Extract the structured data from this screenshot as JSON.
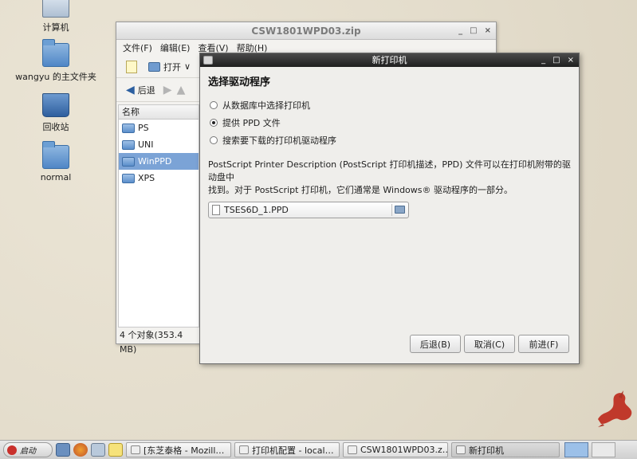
{
  "desktop": {
    "icons": [
      {
        "label": "计算机"
      },
      {
        "label": "wangyu 的主文件夹"
      },
      {
        "label": "回收站"
      },
      {
        "label": "normal"
      }
    ]
  },
  "file_manager": {
    "title": "CSW1801WPD03.zip",
    "window_controls": {
      "min": "_",
      "max": "□",
      "close": "×"
    },
    "menu": [
      "文件(F)",
      "编辑(E)",
      "查看(V)",
      "帮助(H)"
    ],
    "toolbar": {
      "open_label": "打开",
      "dropdown": "∨"
    },
    "nav": {
      "back_label": "后退"
    },
    "list_header": "名称",
    "items": [
      "PS",
      "UNI",
      "WinPPD",
      "XPS"
    ],
    "status": "4 个对象(353.4 MB)"
  },
  "dialog": {
    "title": "新打印机",
    "window_controls": {
      "min": "_",
      "max": "□",
      "close": "×"
    },
    "heading": "选择驱动程序",
    "options": [
      {
        "label": "从数据库中选择打印机",
        "checked": false
      },
      {
        "label": "提供 PPD 文件",
        "checked": true
      },
      {
        "label": "搜索要下载的打印机驱动程序",
        "checked": false
      }
    ],
    "description_line1": "PostScript Printer Description (PostScript 打印机描述，PPD) 文件可以在打印机附带的驱动盘中",
    "description_line2": "找到。对于 PostScript 打印机，它们通常是 Windows® 驱动程序的一部分。",
    "file_value": "TSES6D_1.PPD",
    "buttons": {
      "back": "后退(B)",
      "cancel": "取消(C)",
      "forward": "前进(F)"
    }
  },
  "taskbar": {
    "start_label": "启动",
    "tasks": [
      {
        "label": "[东芝泰格 - Mozill…",
        "active": false
      },
      {
        "label": "打印机配置 - local…",
        "active": false
      },
      {
        "label": "CSW1801WPD03.z…",
        "active": false
      },
      {
        "label": "新打印机",
        "active": true
      }
    ]
  },
  "colors": {
    "selected_row": "#7ba3d6",
    "dialog_title_bg": "#2a2a2a",
    "desktop_bg": "#e6dfcf"
  }
}
